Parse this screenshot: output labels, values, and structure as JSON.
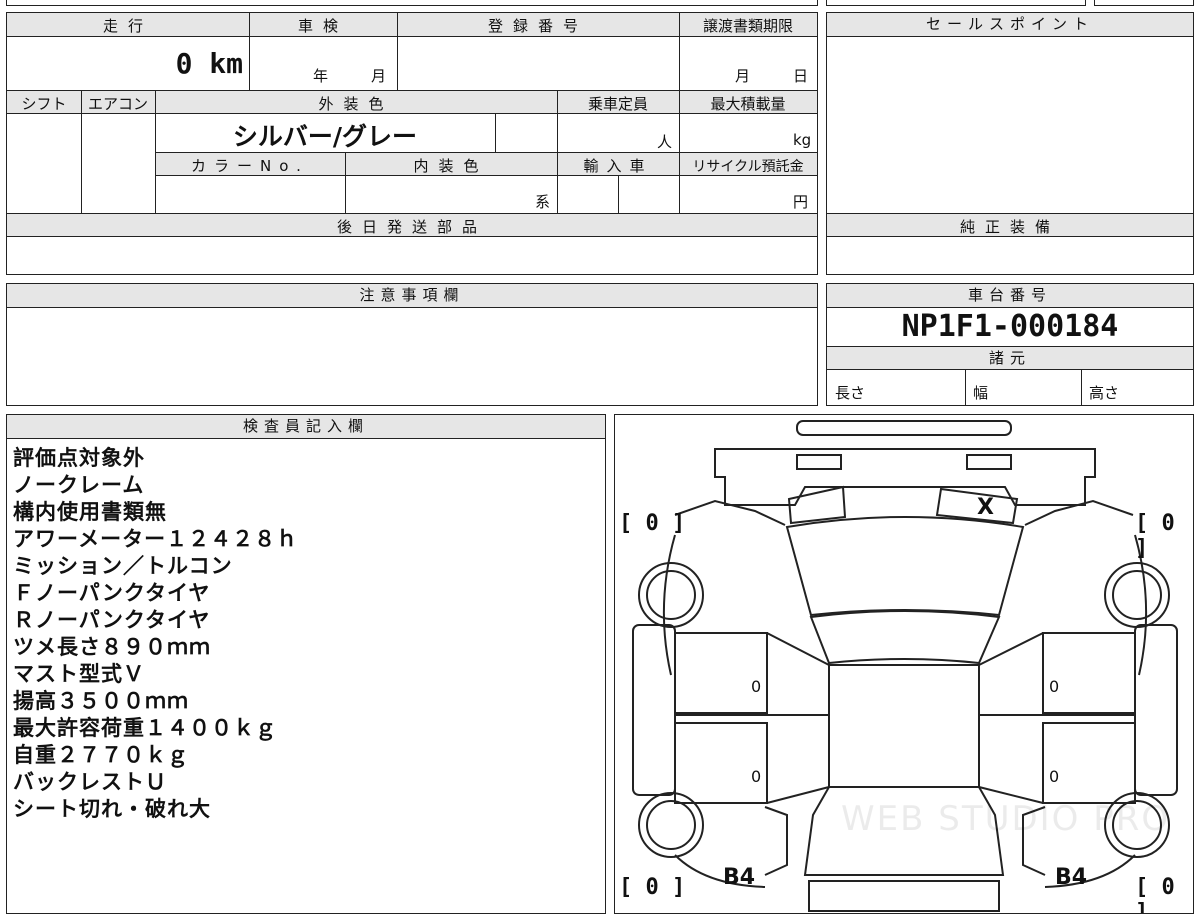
{
  "form": {
    "mileage_label": "走行",
    "mileage_value": "0 km",
    "inspection_label": "車検",
    "inspection_year": "年",
    "inspection_month": "月",
    "registration_label": "登録番号",
    "transfer_deadline_label": "譲渡書類期限",
    "transfer_month": "月",
    "transfer_day": "日",
    "shift_label": "シフト",
    "aircon_label": "エアコン",
    "exterior_color_label": "外装色",
    "exterior_color_value": "シルバー/グレー",
    "capacity_label": "乗車定員",
    "capacity_unit": "人",
    "max_load_label": "最大積載量",
    "max_load_unit": "kg",
    "color_no_label": "カラーNo.",
    "interior_color_label": "内装色",
    "interior_color_suffix": "系",
    "import_label": "輸入車",
    "recycle_label": "リサイクル預託金",
    "recycle_unit": "円",
    "later_parts_label": "後日発送部品"
  },
  "sales_point": {
    "label": "セールスポイント"
  },
  "genuine_equipment": {
    "label": "純正装備"
  },
  "caution": {
    "label": "注意事項欄"
  },
  "chassis": {
    "label": "車台番号",
    "number": "NP1F1-000184",
    "specs_label": "諸元",
    "length_label": "長さ",
    "width_label": "幅",
    "height_label": "高さ"
  },
  "inspector": {
    "label": "検査員記入欄",
    "lines": [
      "評価点対象外",
      "ノークレーム",
      "構内使用書類無",
      "アワーメーター１２４２８ｈ",
      "ミッション／トルコン",
      "Ｆノーパンクタイヤ",
      "Ｒノーパンクタイヤ",
      "ツメ長さ８９０ｍｍ",
      "マスト型式Ｖ",
      "揚高３５００ｍｍ",
      "最大許容荷重１４００ｋｇ",
      "自重２７７０ｋｇ",
      "バックレストＵ",
      "シート切れ・破れ大"
    ]
  },
  "diagram": {
    "tire_fl": "[ 0 ]",
    "tire_fr": "[ 0 ]",
    "tire_rl": "[ 0 ]",
    "tire_rr": "[ 0 ]",
    "mark_x": "X",
    "side_left_1": "0",
    "side_left_2": "0",
    "side_right_1": "0",
    "side_right_2": "0",
    "mark_b4_left": "B4",
    "mark_b4_right": "B4",
    "watermark": "WEB STUDIO PRO"
  }
}
